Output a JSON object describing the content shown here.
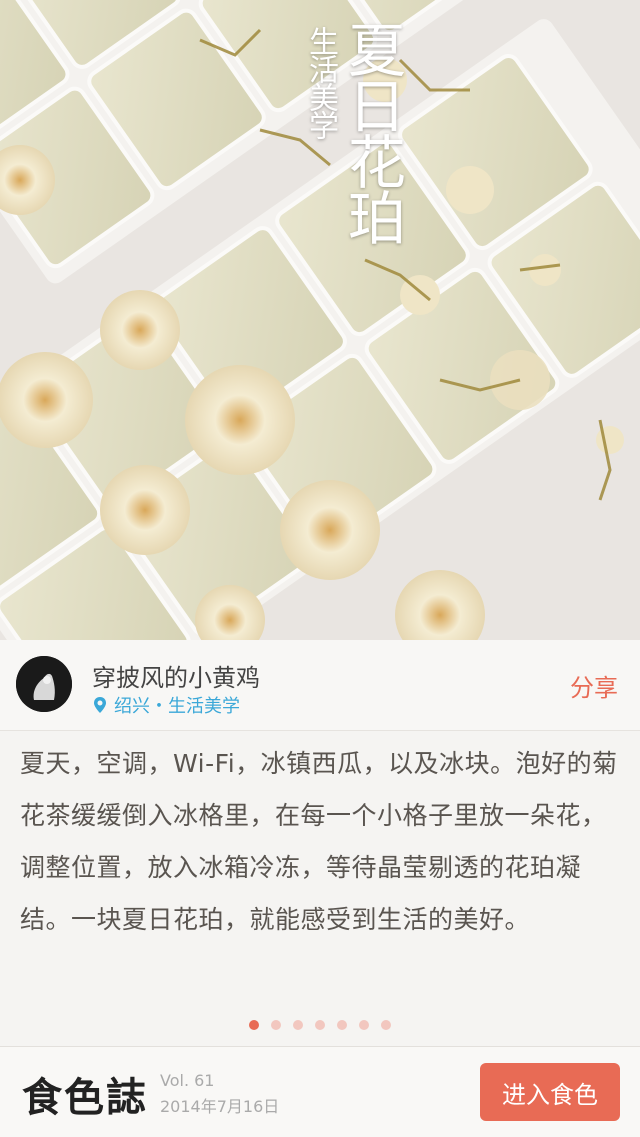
{
  "hero": {
    "title": "夏日花珀",
    "subtitle": "生活美学"
  },
  "author": {
    "name": "穿披风的小黄鸡",
    "location": "绍兴・生活美学",
    "share_label": "分享"
  },
  "article": {
    "text": "夏天，空调，Wi-Fi，冰镇西瓜，以及冰块。泡好的菊花茶缓缓倒入冰格里，在每一个小格子里放一朵花，调整位置，放入冰箱冷冻，等待晶莹剔透的花珀凝结。一块夏日花珀，就能感受到生活的美好。"
  },
  "pager": {
    "total": 7,
    "current": 1
  },
  "footer": {
    "brand": "食色誌",
    "volume": "Vol. 61",
    "date": "2014年7月16日",
    "enter_label": "进入食色"
  },
  "colors": {
    "accent": "#e86b55",
    "link": "#3ba8d8"
  }
}
